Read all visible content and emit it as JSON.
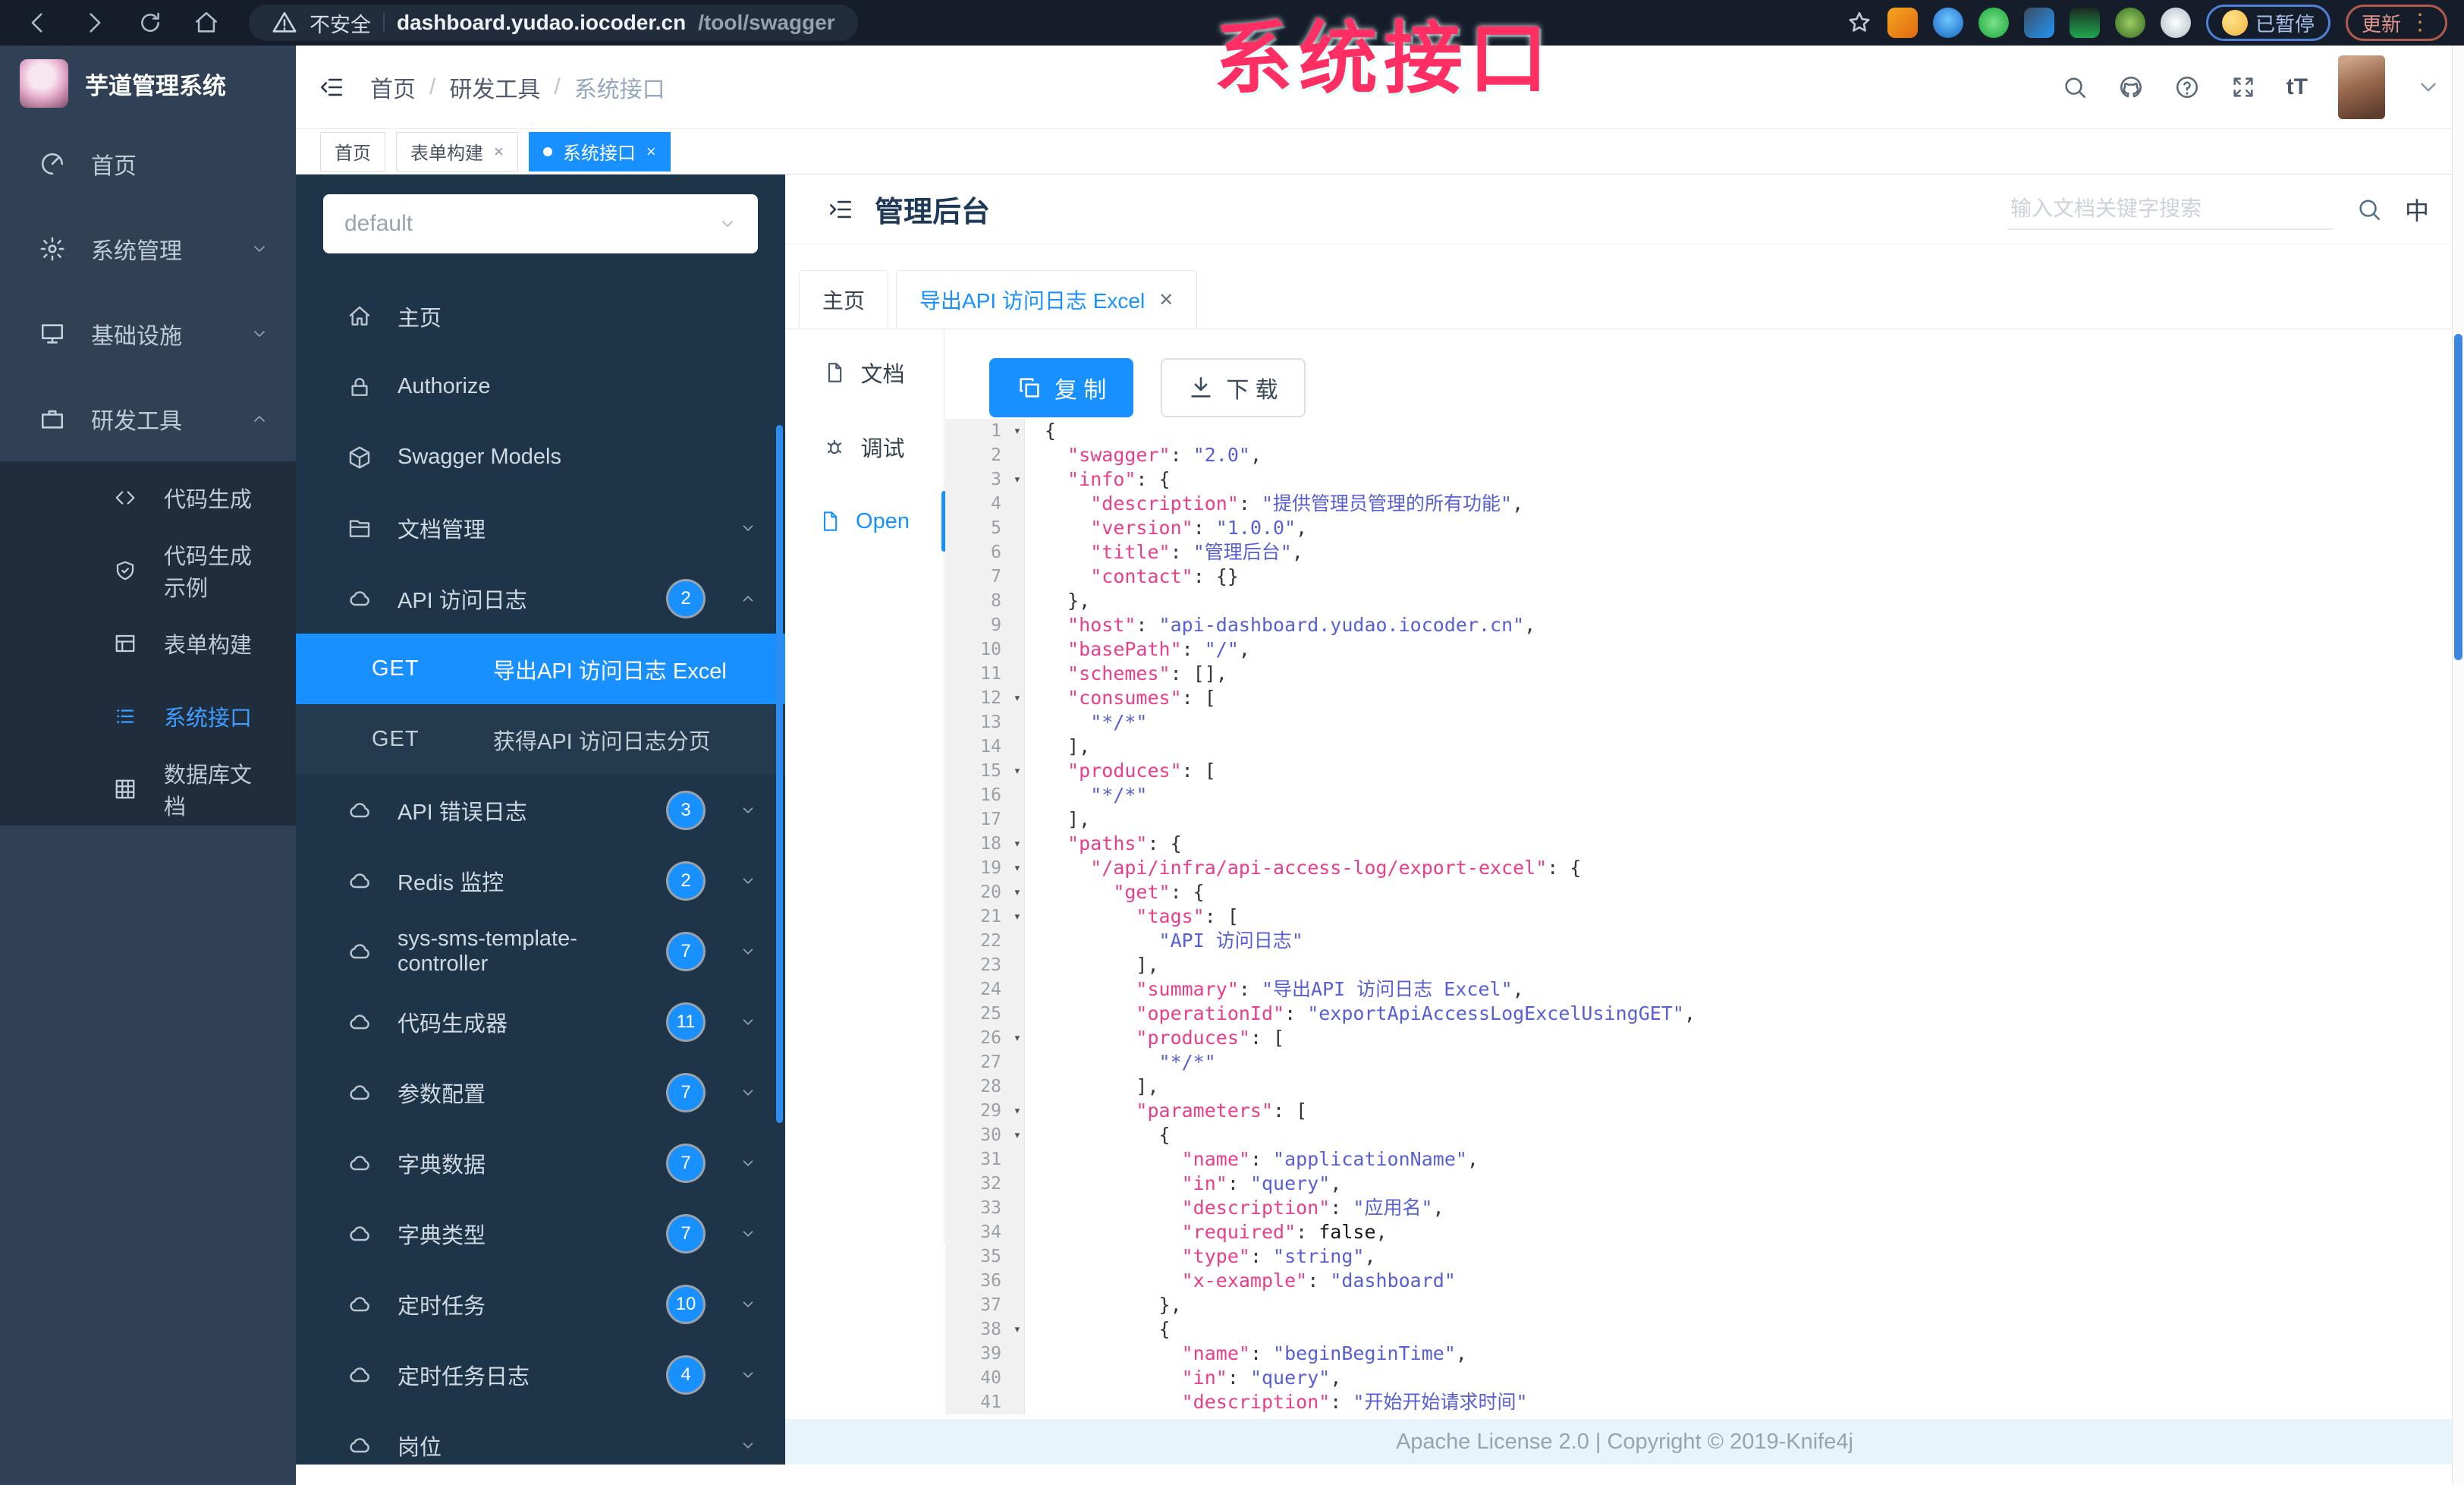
{
  "browser": {
    "security_label": "不安全",
    "url_host": "dashboard.yudao.iocoder.cn",
    "url_path": "/tool/swagger",
    "paused_label": "已暂停",
    "update_label": "更新",
    "extensions": [
      "orange-extension-icon",
      "blue-drop-extension-icon",
      "green-check-extension-icon",
      "blue-puzzle-extension-icon",
      "green-gn-extension-icon",
      "green-alien-extension-icon",
      "white-star-extension-icon"
    ]
  },
  "watermark": "系统接口",
  "sidebar": {
    "title": "芋道管理系统",
    "items": [
      {
        "label": "首页",
        "icon": "dashboard",
        "chevron": ""
      },
      {
        "label": "系统管理",
        "icon": "gear",
        "chevron": "down"
      },
      {
        "label": "基础设施",
        "icon": "monitor",
        "chevron": "down"
      },
      {
        "label": "研发工具",
        "icon": "suitcase",
        "chevron": "up"
      }
    ],
    "submenu": [
      {
        "label": "代码生成",
        "icon": "code",
        "active": false
      },
      {
        "label": "代码生成示例",
        "icon": "shield",
        "active": false
      },
      {
        "label": "表单构建",
        "icon": "table",
        "active": false
      },
      {
        "label": "系统接口",
        "icon": "list",
        "active": true
      },
      {
        "label": "数据库文档",
        "icon": "grid",
        "active": false
      }
    ]
  },
  "header": {
    "breadcrumb": [
      "首页",
      "研发工具",
      "系统接口"
    ]
  },
  "tags": [
    {
      "label": "首页",
      "closable": false,
      "active": false
    },
    {
      "label": "表单构建",
      "closable": true,
      "active": false
    },
    {
      "label": "系统接口",
      "closable": true,
      "active": true
    }
  ],
  "swagger_nav": {
    "group_value": "default",
    "items": [
      {
        "label": "主页",
        "icon": "home2"
      },
      {
        "label": "Authorize",
        "icon": "lock"
      },
      {
        "label": "Swagger Models",
        "icon": "cube"
      },
      {
        "label": "文档管理",
        "icon": "folder",
        "chevron": "down"
      },
      {
        "label": "API 访问日志",
        "icon": "cloud",
        "badge": "2",
        "chevron": "up",
        "children": [
          {
            "method": "GET",
            "label": "导出API 访问日志 Excel",
            "active": true
          },
          {
            "method": "GET",
            "label": "获得API 访问日志分页",
            "active": false
          }
        ]
      },
      {
        "label": "API 错误日志",
        "icon": "cloud",
        "badge": "3",
        "chevron": "down"
      },
      {
        "label": "Redis 监控",
        "icon": "cloud",
        "badge": "2",
        "chevron": "down"
      },
      {
        "label": "sys-sms-template-controller",
        "icon": "cloud",
        "badge": "7",
        "chevron": "down"
      },
      {
        "label": "代码生成器",
        "icon": "cloud",
        "badge": "11",
        "chevron": "down"
      },
      {
        "label": "参数配置",
        "icon": "cloud",
        "badge": "7",
        "chevron": "down"
      },
      {
        "label": "字典数据",
        "icon": "cloud",
        "badge": "7",
        "chevron": "down"
      },
      {
        "label": "字典类型",
        "icon": "cloud",
        "badge": "7",
        "chevron": "down"
      },
      {
        "label": "定时任务",
        "icon": "cloud",
        "badge": "10",
        "chevron": "down"
      },
      {
        "label": "定时任务日志",
        "icon": "cloud",
        "badge": "4",
        "chevron": "down"
      },
      {
        "label": "岗位",
        "icon": "cloud",
        "badge": "",
        "chevron": "down"
      }
    ]
  },
  "content": {
    "page_title": "管理后台",
    "search_placeholder": "输入文档关键字搜索",
    "lang_label": "中",
    "doc_tabs": [
      {
        "label": "主页",
        "closable": false,
        "active": false
      },
      {
        "label": "导出API 访问日志 Excel",
        "closable": true,
        "active": true
      }
    ],
    "rail": [
      {
        "label": "文档",
        "icon": "file",
        "active": false
      },
      {
        "label": "调试",
        "icon": "bug",
        "active": false
      },
      {
        "label": "Open",
        "icon": "file",
        "active": true
      }
    ],
    "copy_label": "复 制",
    "download_label": "下 载",
    "footer": "Apache License 2.0 | Copyright © 2019-Knife4j"
  },
  "code": {
    "lines": [
      {
        "n": 1,
        "fold": true,
        "t": [
          [
            "p",
            "{"
          ]
        ]
      },
      {
        "n": 2,
        "fold": false,
        "t": [
          [
            "p",
            "  "
          ],
          [
            "k",
            "\"swagger\""
          ],
          [
            "p",
            ": "
          ],
          [
            "s",
            "\"2.0\""
          ],
          [
            "p",
            ","
          ]
        ]
      },
      {
        "n": 3,
        "fold": true,
        "t": [
          [
            "p",
            "  "
          ],
          [
            "k",
            "\"info\""
          ],
          [
            "p",
            ": {"
          ]
        ]
      },
      {
        "n": 4,
        "fold": false,
        "t": [
          [
            "p",
            "    "
          ],
          [
            "k",
            "\"description\""
          ],
          [
            "p",
            ": "
          ],
          [
            "s",
            "\"提供管理员管理的所有功能\""
          ],
          [
            "p",
            ","
          ]
        ]
      },
      {
        "n": 5,
        "fold": false,
        "t": [
          [
            "p",
            "    "
          ],
          [
            "k",
            "\"version\""
          ],
          [
            "p",
            ": "
          ],
          [
            "s",
            "\"1.0.0\""
          ],
          [
            "p",
            ","
          ]
        ]
      },
      {
        "n": 6,
        "fold": false,
        "t": [
          [
            "p",
            "    "
          ],
          [
            "k",
            "\"title\""
          ],
          [
            "p",
            ": "
          ],
          [
            "s",
            "\"管理后台\""
          ],
          [
            "p",
            ","
          ]
        ]
      },
      {
        "n": 7,
        "fold": false,
        "t": [
          [
            "p",
            "    "
          ],
          [
            "k",
            "\"contact\""
          ],
          [
            "p",
            ": {}"
          ]
        ]
      },
      {
        "n": 8,
        "fold": false,
        "t": [
          [
            "p",
            "  },"
          ]
        ]
      },
      {
        "n": 9,
        "fold": false,
        "t": [
          [
            "p",
            "  "
          ],
          [
            "k",
            "\"host\""
          ],
          [
            "p",
            ": "
          ],
          [
            "s",
            "\"api-dashboard.yudao.iocoder.cn\""
          ],
          [
            "p",
            ","
          ]
        ]
      },
      {
        "n": 10,
        "fold": false,
        "t": [
          [
            "p",
            "  "
          ],
          [
            "k",
            "\"basePath\""
          ],
          [
            "p",
            ": "
          ],
          [
            "s",
            "\"/\""
          ],
          [
            "p",
            ","
          ]
        ]
      },
      {
        "n": 11,
        "fold": false,
        "t": [
          [
            "p",
            "  "
          ],
          [
            "k",
            "\"schemes\""
          ],
          [
            "p",
            ": [],"
          ]
        ]
      },
      {
        "n": 12,
        "fold": true,
        "t": [
          [
            "p",
            "  "
          ],
          [
            "k",
            "\"consumes\""
          ],
          [
            "p",
            ": ["
          ]
        ]
      },
      {
        "n": 13,
        "fold": false,
        "t": [
          [
            "p",
            "    "
          ],
          [
            "s",
            "\"*/*\""
          ]
        ]
      },
      {
        "n": 14,
        "fold": false,
        "t": [
          [
            "p",
            "  ],"
          ]
        ]
      },
      {
        "n": 15,
        "fold": true,
        "t": [
          [
            "p",
            "  "
          ],
          [
            "k",
            "\"produces\""
          ],
          [
            "p",
            ": ["
          ]
        ]
      },
      {
        "n": 16,
        "fold": false,
        "t": [
          [
            "p",
            "    "
          ],
          [
            "s",
            "\"*/*\""
          ]
        ]
      },
      {
        "n": 17,
        "fold": false,
        "t": [
          [
            "p",
            "  ],"
          ]
        ]
      },
      {
        "n": 18,
        "fold": true,
        "t": [
          [
            "p",
            "  "
          ],
          [
            "k",
            "\"paths\""
          ],
          [
            "p",
            ": {"
          ]
        ]
      },
      {
        "n": 19,
        "fold": true,
        "t": [
          [
            "p",
            "    "
          ],
          [
            "k",
            "\"/api/infra/api-access-log/export-excel\""
          ],
          [
            "p",
            ": {"
          ]
        ]
      },
      {
        "n": 20,
        "fold": true,
        "t": [
          [
            "p",
            "      "
          ],
          [
            "k",
            "\"get\""
          ],
          [
            "p",
            ": {"
          ]
        ]
      },
      {
        "n": 21,
        "fold": true,
        "t": [
          [
            "p",
            "        "
          ],
          [
            "k",
            "\"tags\""
          ],
          [
            "p",
            ": ["
          ]
        ]
      },
      {
        "n": 22,
        "fold": false,
        "t": [
          [
            "p",
            "          "
          ],
          [
            "s",
            "\"API 访问日志\""
          ]
        ]
      },
      {
        "n": 23,
        "fold": false,
        "t": [
          [
            "p",
            "        ],"
          ]
        ]
      },
      {
        "n": 24,
        "fold": false,
        "t": [
          [
            "p",
            "        "
          ],
          [
            "k",
            "\"summary\""
          ],
          [
            "p",
            ": "
          ],
          [
            "s",
            "\"导出API 访问日志 Excel\""
          ],
          [
            "p",
            ","
          ]
        ]
      },
      {
        "n": 25,
        "fold": false,
        "t": [
          [
            "p",
            "        "
          ],
          [
            "k",
            "\"operationId\""
          ],
          [
            "p",
            ": "
          ],
          [
            "s",
            "\"exportApiAccessLogExcelUsingGET\""
          ],
          [
            "p",
            ","
          ]
        ]
      },
      {
        "n": 26,
        "fold": true,
        "t": [
          [
            "p",
            "        "
          ],
          [
            "k",
            "\"produces\""
          ],
          [
            "p",
            ": ["
          ]
        ]
      },
      {
        "n": 27,
        "fold": false,
        "t": [
          [
            "p",
            "          "
          ],
          [
            "s",
            "\"*/*\""
          ]
        ]
      },
      {
        "n": 28,
        "fold": false,
        "t": [
          [
            "p",
            "        ],"
          ]
        ]
      },
      {
        "n": 29,
        "fold": true,
        "t": [
          [
            "p",
            "        "
          ],
          [
            "k",
            "\"parameters\""
          ],
          [
            "p",
            ": ["
          ]
        ]
      },
      {
        "n": 30,
        "fold": true,
        "t": [
          [
            "p",
            "          {"
          ]
        ]
      },
      {
        "n": 31,
        "fold": false,
        "t": [
          [
            "p",
            "            "
          ],
          [
            "k",
            "\"name\""
          ],
          [
            "p",
            ": "
          ],
          [
            "s",
            "\"applicationName\""
          ],
          [
            "p",
            ","
          ]
        ]
      },
      {
        "n": 32,
        "fold": false,
        "t": [
          [
            "p",
            "            "
          ],
          [
            "k",
            "\"in\""
          ],
          [
            "p",
            ": "
          ],
          [
            "s",
            "\"query\""
          ],
          [
            "p",
            ","
          ]
        ]
      },
      {
        "n": 33,
        "fold": false,
        "t": [
          [
            "p",
            "            "
          ],
          [
            "k",
            "\"description\""
          ],
          [
            "p",
            ": "
          ],
          [
            "s",
            "\"应用名\""
          ],
          [
            "p",
            ","
          ]
        ]
      },
      {
        "n": 34,
        "fold": false,
        "t": [
          [
            "p",
            "            "
          ],
          [
            "k",
            "\"required\""
          ],
          [
            "p",
            ": "
          ],
          [
            "b",
            "false"
          ],
          [
            "p",
            ","
          ]
        ]
      },
      {
        "n": 35,
        "fold": false,
        "t": [
          [
            "p",
            "            "
          ],
          [
            "k",
            "\"type\""
          ],
          [
            "p",
            ": "
          ],
          [
            "s",
            "\"string\""
          ],
          [
            "p",
            ","
          ]
        ]
      },
      {
        "n": 36,
        "fold": false,
        "t": [
          [
            "p",
            "            "
          ],
          [
            "k",
            "\"x-example\""
          ],
          [
            "p",
            ": "
          ],
          [
            "s",
            "\"dashboard\""
          ]
        ]
      },
      {
        "n": 37,
        "fold": false,
        "t": [
          [
            "p",
            "          },"
          ]
        ]
      },
      {
        "n": 38,
        "fold": true,
        "t": [
          [
            "p",
            "          {"
          ]
        ]
      },
      {
        "n": 39,
        "fold": false,
        "t": [
          [
            "p",
            "            "
          ],
          [
            "k",
            "\"name\""
          ],
          [
            "p",
            ": "
          ],
          [
            "s",
            "\"beginBeginTime\""
          ],
          [
            "p",
            ","
          ]
        ]
      },
      {
        "n": 40,
        "fold": false,
        "t": [
          [
            "p",
            "            "
          ],
          [
            "k",
            "\"in\""
          ],
          [
            "p",
            ": "
          ],
          [
            "s",
            "\"query\""
          ],
          [
            "p",
            ","
          ]
        ]
      },
      {
        "n": 41,
        "fold": false,
        "t": [
          [
            "p",
            "            "
          ],
          [
            "k",
            "\"description\""
          ],
          [
            "p",
            ": "
          ],
          [
            "s",
            "\"开始开始请求时间\""
          ]
        ]
      }
    ]
  }
}
